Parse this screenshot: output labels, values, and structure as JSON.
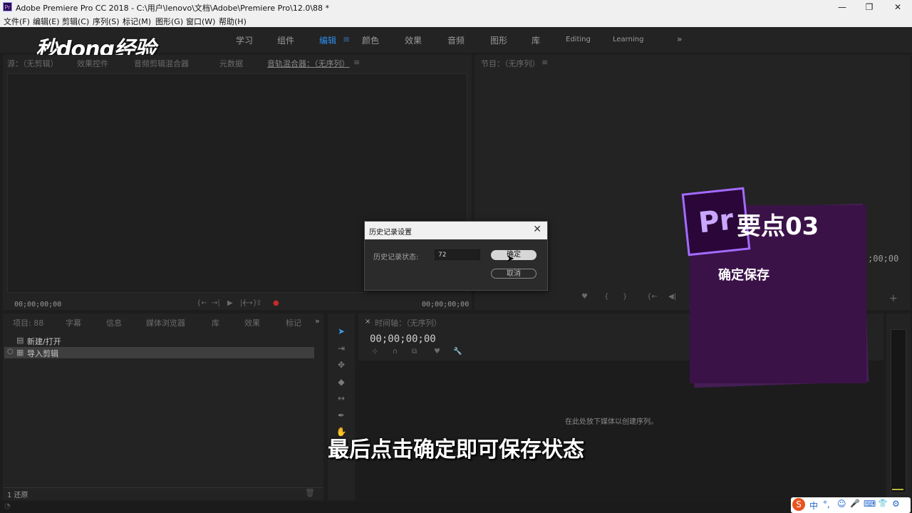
{
  "window": {
    "title": "Adobe Premiere Pro CC 2018 - C:\\用户\\lenovo\\文档\\Adobe\\Premiere Pro\\12.0\\88 *",
    "app_icon": "Pr"
  },
  "menu": [
    "文件(F)",
    "编辑(E)",
    "剪辑(C)",
    "序列(S)",
    "标记(M)",
    "图形(G)",
    "窗口(W)",
    "帮助(H)"
  ],
  "workspaces": {
    "items": [
      "学习",
      "组件",
      "编辑",
      "颜色",
      "效果",
      "音频",
      "图形",
      "库",
      "Editing",
      "Learning"
    ],
    "active": "编辑",
    "more": "»"
  },
  "logo": "秒dong经验",
  "source_panel": {
    "tabs": [
      "源：（无剪辑）",
      "效果控件",
      "音频剪辑混合器",
      "元数据",
      "音轨混合器：（无序列）"
    ],
    "timecode_left": "00;00;00;00",
    "timecode_right": "00;00;00;00"
  },
  "program_panel": {
    "tab": "节目：（无序列）",
    "timecode_right": ";00;00"
  },
  "project_panel": {
    "tabs": [
      "项目: 88",
      "字幕",
      "信息",
      "媒体浏览器",
      "库",
      "效果",
      "标记"
    ],
    "items": [
      {
        "label": "新建/打开"
      },
      {
        "label": "导入剪辑"
      }
    ],
    "footer": "1 还原"
  },
  "timeline_panel": {
    "tab": "时间轴：（无序列）",
    "timecode": "00;00;00;00",
    "drop_hint": "在此处放下媒体以创建序列。"
  },
  "dialog": {
    "title": "历史记录设置",
    "field_label": "历史记录状态:",
    "field_value": "72",
    "ok": "确定",
    "cancel": "取消"
  },
  "overlay": {
    "badge": "Pr",
    "title": "要点03",
    "subtitle": "确定保存",
    "accent": "#a46bff"
  },
  "caption": "最后点击确定即可保存状态",
  "ime_tray": [
    "S",
    "中",
    "°,",
    "☺",
    "🎤",
    "⌨",
    "👕",
    "⚙"
  ]
}
